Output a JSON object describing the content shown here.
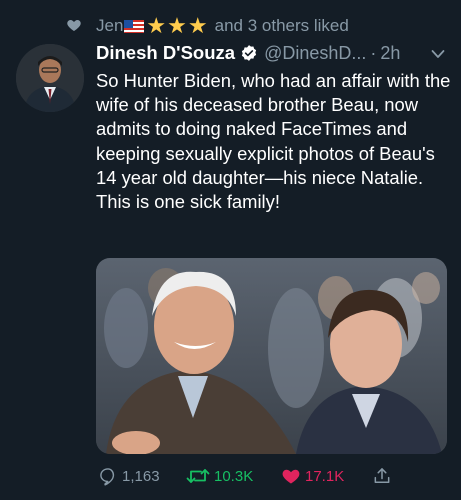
{
  "social_context": {
    "user": "Jen",
    "tail": "and 3 others liked",
    "icon": "heart-icon",
    "flag": "us-flag-emoji",
    "stars": [
      "★",
      "★",
      "★"
    ]
  },
  "tweet": {
    "author_name": "Dinesh D'Souza",
    "handle": "@DineshD...",
    "separator": "·",
    "time": "2h",
    "text": "So Hunter Biden, who had an affair with the wife of his deceased brother Beau, now admits to doing naked FaceTimes and keeping sexually explicit photos of Beau's 14 year old daughter—his niece Natalie. This is one sick family!"
  },
  "actions": {
    "reply_count": "1,163",
    "retweet_count": "10.3K",
    "like_count": "17.1K"
  },
  "colors": {
    "background": "#141d26",
    "secondary_text": "#8899a6",
    "retweet_green": "#17bf63",
    "like_red": "#e0245e",
    "verified_blue": "#1da1f2",
    "star_yellow": "#ffcc4d"
  }
}
